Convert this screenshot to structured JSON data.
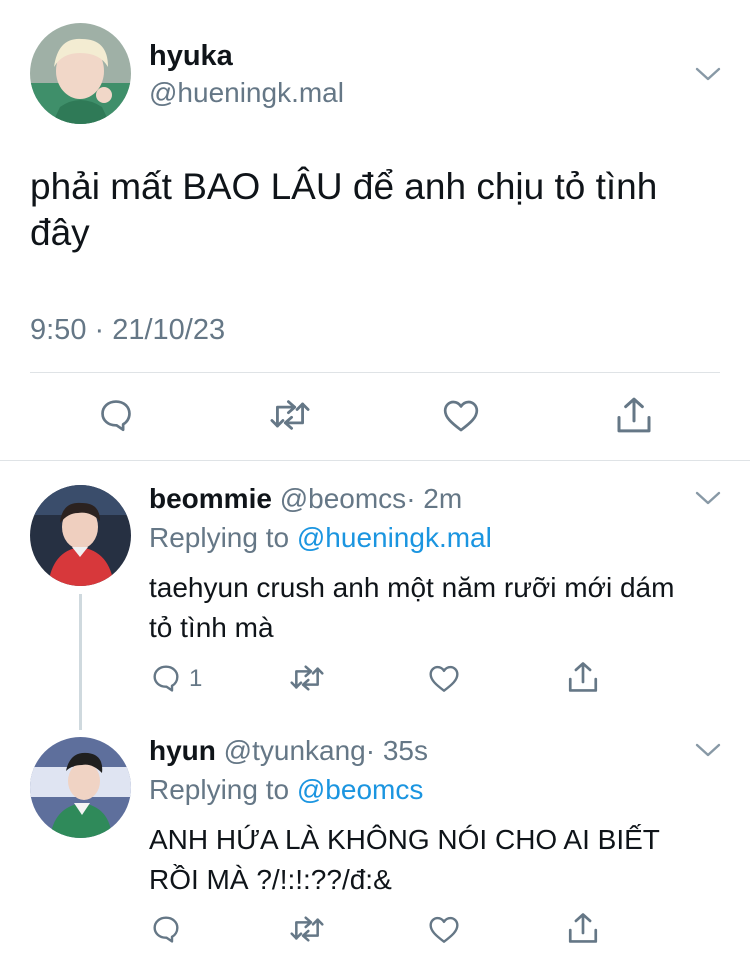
{
  "main_tweet": {
    "display_name": "hyuka",
    "handle": "@hueningk.mal",
    "text_line1": "phải mất BAO LÂU để anh chịu tỏ tình",
    "text_line2": "đây",
    "timestamp": "9:50 · 21/10/23"
  },
  "replies": [
    {
      "display_name": "beommie",
      "handle": "@beomcs",
      "time": "· 2m",
      "replying_label": "Replying to",
      "replying_to": "@hueningk.mal",
      "text_line1": "taehyun crush anh một năm rưỡi mới dám",
      "text_line2": "tỏ tình mà",
      "reply_count": "1"
    },
    {
      "display_name": "hyun",
      "handle": "@tyunkang",
      "time": "· 35s",
      "replying_label": "Replying to",
      "replying_to": "@beomcs",
      "text_line1": "ANH HỨA LÀ KHÔNG NÓI CHO AI BIẾT",
      "text_line2": "RỒI MÀ ?/!:!:??/đ:&"
    }
  ],
  "icons": [
    "chevron-down-icon",
    "reply-icon",
    "retweet-icon",
    "like-icon",
    "share-icon"
  ],
  "colors": {
    "link": "#1b95e0",
    "secondary": "#657786",
    "divider": "#dfe3e6"
  }
}
